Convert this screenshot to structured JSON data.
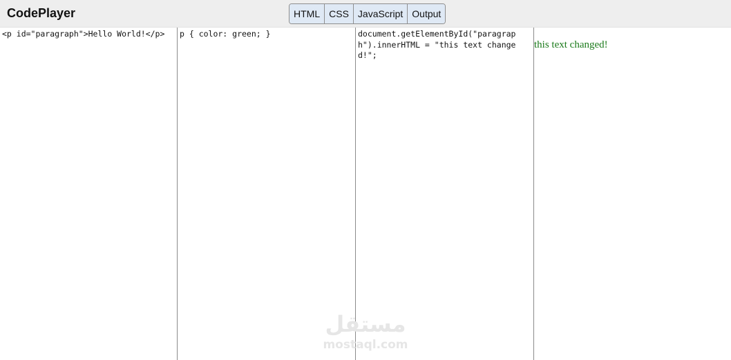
{
  "app": {
    "title": "CodePlayer"
  },
  "toolbar": {
    "buttons": [
      {
        "label": "HTML"
      },
      {
        "label": "CSS"
      },
      {
        "label": "JavaScript"
      },
      {
        "label": "Output"
      }
    ]
  },
  "panels": {
    "html_code": "<p id=\"paragraph\">Hello World!</p>",
    "css_code": "p { color: green; }",
    "js_code": "document.getElementById(\"paragraph\").innerHTML = \"this text changed!\";",
    "output_text": "this text changed!"
  },
  "watermark": {
    "arabic": "مستقل",
    "latin": "mostaql.com"
  },
  "colors": {
    "topbar_bg": "#eeeeee",
    "toggle_bg": "#dfe9f5",
    "output_text": "#1a7a1a",
    "panel_border": "#8a8a8a"
  }
}
